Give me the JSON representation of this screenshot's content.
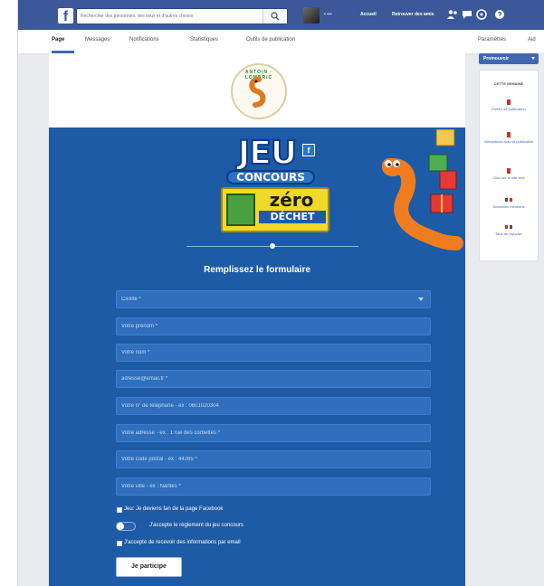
{
  "topbar": {
    "search_placeholder": "Rechercher des personnes, des lieux et d'autres choses",
    "user_name": "▪ ▪▪▪",
    "nav": [
      "Accueil",
      "Retrouver des amis"
    ]
  },
  "subnav": {
    "tabs": [
      "Page",
      "Messages",
      "Notifications",
      "Statistiques",
      "Outils de publication"
    ],
    "right": [
      "Paramètres",
      "Aid"
    ]
  },
  "app": {
    "logo_text": "ANTOIN · LOMBRIC",
    "title_jeu": "JEU",
    "title_concours": "CONCOURS",
    "fb_badge": "f",
    "zero": "zéro",
    "dechet": "DÉCHET",
    "form_title": "Remplissez le formulaire",
    "fields": [
      "Civilité *",
      "Votre prénom *",
      "Votre nom *",
      "adresse@email.fr *",
      "Votre n° de téléphone - ex : 0601020304",
      "Votre adresse - ex : 1 rue des corbettes *",
      "Votre code postal - ex : 44265 *",
      "Votre ville - ex : Nantes *"
    ],
    "checkbox_fan": "Jeu: Je deviens fan de la page Facebook",
    "toggle_rules": "J'accepte le règlement du jeu concours",
    "checkbox_news": "J'accepte de recevoir des informations par email",
    "submit": "Je participe"
  },
  "sidebar": {
    "promote": "Promouvoir",
    "week_title": "CETTE SEMAINE",
    "items": [
      "Portée de publication",
      "Interactions avec la publication",
      "Clics sur le site web",
      "Nouvelles mentions",
      "Taux de réponse"
    ]
  },
  "colors": {
    "fb_blue": "#3b5998",
    "app_blue": "#1e5ba6",
    "accent": "#4267b2"
  }
}
